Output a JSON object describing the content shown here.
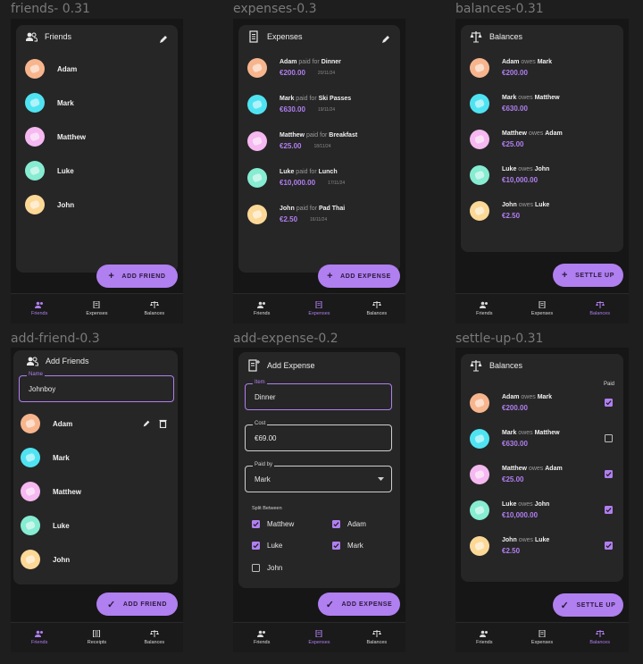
{
  "colors": {
    "accent": "#b07ff0",
    "surface": "#262626",
    "screen": "#161616",
    "canvas": "#1e1e1e"
  },
  "frames": {
    "friends": {
      "label": "friends- 0.31",
      "title": "Friends",
      "fab": "ADD FRIEND",
      "people": [
        "Adam",
        "Mark",
        "Matthew",
        "Luke",
        "John"
      ]
    },
    "expenses": {
      "label": "expenses-0.3",
      "title": "Expenses",
      "fab": "ADD EXPENSE",
      "items": [
        {
          "who": "Adam",
          "mid": "paid for",
          "what": "Dinner",
          "amount": "€200.00",
          "date": "20/11/24"
        },
        {
          "who": "Mark",
          "mid": "paid for",
          "what": "Ski Passes",
          "amount": "€630.00",
          "date": "19/11/24"
        },
        {
          "who": "Matthew",
          "mid": "paid for",
          "what": "Breakfast",
          "amount": "€25.00",
          "date": "18/11/24"
        },
        {
          "who": "Luke",
          "mid": "paid for",
          "what": "Lunch",
          "amount": "€10,000.00",
          "date": "17/11/24"
        },
        {
          "who": "John",
          "mid": "paid for",
          "what": "Pad Thai",
          "amount": "€2.50",
          "date": "16/11/24"
        }
      ]
    },
    "balances": {
      "label": "balances-0.31",
      "title": "Balances",
      "fab": "SETTLE UP",
      "items": [
        {
          "from": "Adam",
          "mid": "owes",
          "to": "Mark",
          "amount": "€200.00"
        },
        {
          "from": "Mark",
          "mid": "owes",
          "to": "Matthew",
          "amount": "€630.00"
        },
        {
          "from": "Matthew",
          "mid": "owes",
          "to": "Adam",
          "amount": "€25.00"
        },
        {
          "from": "Luke",
          "mid": "owes",
          "to": "John",
          "amount": "€10,000.00"
        },
        {
          "from": "John",
          "mid": "owes",
          "to": "Luke",
          "amount": "€2.50"
        }
      ]
    },
    "add_friend": {
      "label": "add-friend-0.3",
      "title": "Add Friends",
      "field_label": "Name",
      "field_value": "Johnboy",
      "fab": "ADD FRIEND",
      "people": [
        "Adam",
        "Mark",
        "Matthew",
        "Luke",
        "John"
      ]
    },
    "add_expense": {
      "label": "add-expense-0.2",
      "title": "Add Expense",
      "item_label": "Item",
      "item_value": "Dinner",
      "cost_label": "Cost",
      "cost_value": "€69.00",
      "paid_label": "Paid by",
      "paid_value": "Mark",
      "split_label": "Split Between",
      "fab": "ADD EXPENSE",
      "split": [
        {
          "name": "Matthew",
          "checked": true
        },
        {
          "name": "Adam",
          "checked": true
        },
        {
          "name": "Luke",
          "checked": true
        },
        {
          "name": "Mark",
          "checked": true
        },
        {
          "name": "John",
          "checked": false
        }
      ]
    },
    "settle_up": {
      "label": "settle-up-0.31",
      "title": "Balances",
      "paid_header": "Paid",
      "fab": "SETTLE UP",
      "items": [
        {
          "from": "Adam",
          "mid": "owes",
          "to": "Mark",
          "amount": "€200.00",
          "paid": true
        },
        {
          "from": "Mark",
          "mid": "owes",
          "to": "Matthew",
          "amount": "€630.00",
          "paid": false
        },
        {
          "from": "Matthew",
          "mid": "owes",
          "to": "Adam",
          "amount": "€25.00",
          "paid": true
        },
        {
          "from": "Luke",
          "mid": "owes",
          "to": "John",
          "amount": "€10,000.00",
          "paid": true
        },
        {
          "from": "John",
          "mid": "owes",
          "to": "Luke",
          "amount": "€2.50",
          "paid": true
        }
      ]
    }
  },
  "nav": {
    "friends": [
      "Friends",
      "Expenses",
      "Balances"
    ],
    "add_friend": [
      "Friends",
      "Receipts",
      "Balances"
    ]
  },
  "avatar_colors": [
    "#f7b58e",
    "#4fe3f2",
    "#f5b8f0",
    "#86ecd2",
    "#fcd897"
  ]
}
